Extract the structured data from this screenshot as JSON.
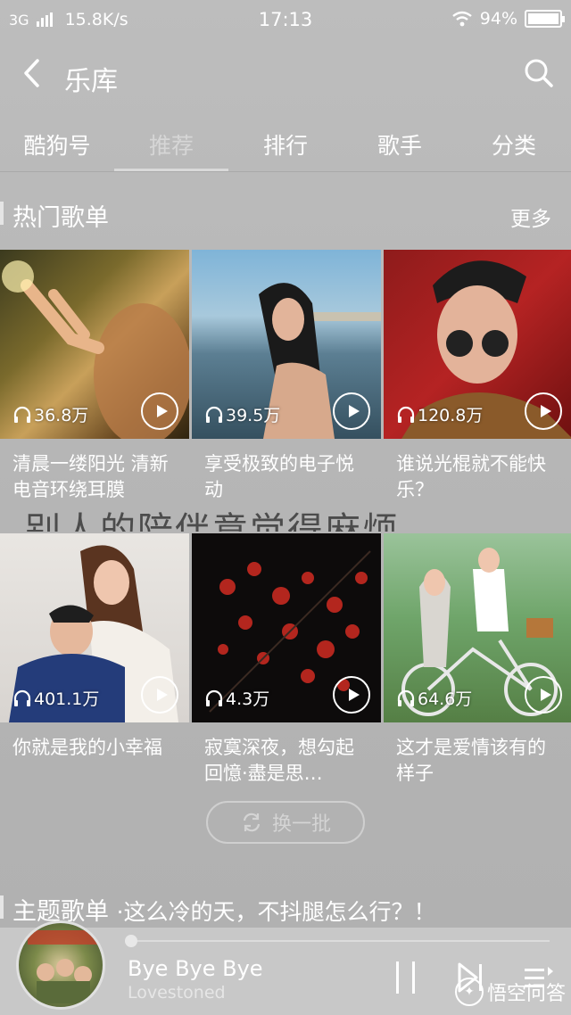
{
  "status_bar": {
    "network": "3G",
    "speed": "15.8K/s",
    "time": "17:13",
    "battery": "94%"
  },
  "nav": {
    "title": "乐库",
    "back_icon": "chevron-left-icon",
    "search_icon": "search-icon"
  },
  "tabs": [
    {
      "label": "酷狗号",
      "active": false
    },
    {
      "label": "推荐",
      "active": true
    },
    {
      "label": "排行",
      "active": false
    },
    {
      "label": "歌手",
      "active": false
    },
    {
      "label": "分类",
      "active": false
    }
  ],
  "hot_section": {
    "title": "热门歌单",
    "more": "更多"
  },
  "playlists": [
    {
      "count": "36.8万",
      "title": "清晨一缕阳光 清新电音环绕耳膜"
    },
    {
      "count": "39.5万",
      "title": "享受极致的电子悦动"
    },
    {
      "count": "120.8万",
      "title": "谁说光棍就不能快乐？"
    },
    {
      "count": "401.1万",
      "title": "你就是我的小幸福"
    },
    {
      "count": "4.3万",
      "title": "寂寞深夜，想勾起回憶·盡是思…"
    },
    {
      "count": "64.6万",
      "title": "这才是爱情该有的样子"
    }
  ],
  "overlay_caption": "别人的陪伴意觉得麻烦",
  "refresh_label": "换一批",
  "theme_section": {
    "title": "主题歌单",
    "subtitle": "·这么冷的天，不抖腿怎么行？！"
  },
  "player": {
    "song": "Bye Bye Bye",
    "artist": "Lovestoned",
    "progress": 0.0
  },
  "watermark": "悟空问答"
}
